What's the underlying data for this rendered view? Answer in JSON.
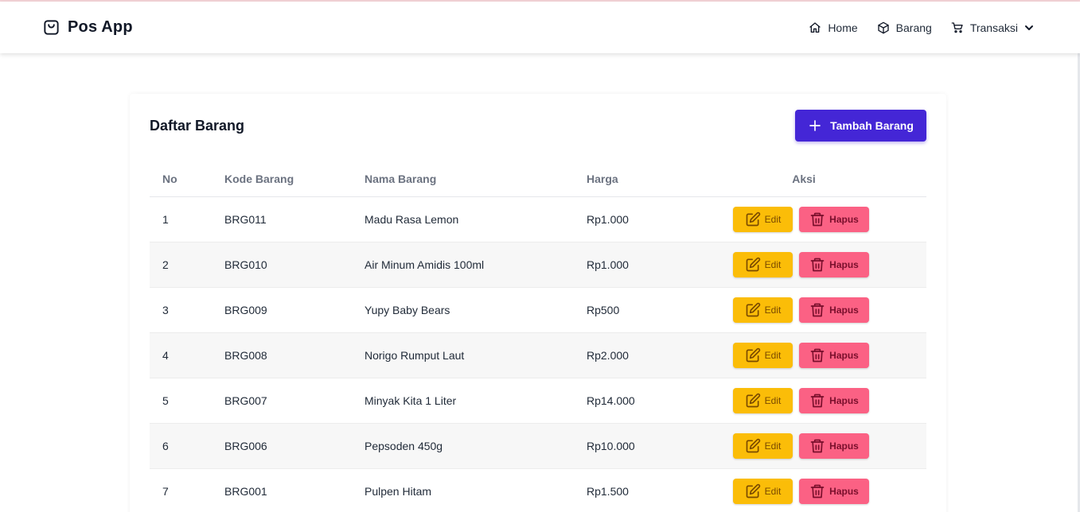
{
  "app": {
    "title": "Pos App"
  },
  "nav": {
    "home_label": "Home",
    "barang_label": "Barang",
    "transaksi_label": "Transaksi"
  },
  "page": {
    "title": "Daftar Barang",
    "add_button_label": "Tambah Barang"
  },
  "table": {
    "headers": {
      "no": "No",
      "kode": "Kode Barang",
      "nama": "Nama Barang",
      "harga": "Harga",
      "aksi": "Aksi"
    },
    "edit_label": "Edit",
    "delete_label": "Hapus",
    "rows": [
      {
        "no": "1",
        "kode": "BRG011",
        "nama": "Madu Rasa Lemon",
        "harga": "Rp1.000"
      },
      {
        "no": "2",
        "kode": "BRG010",
        "nama": "Air Minum Amidis 100ml",
        "harga": "Rp1.000"
      },
      {
        "no": "3",
        "kode": "BRG009",
        "nama": "Yupy Baby Bears",
        "harga": "Rp500"
      },
      {
        "no": "4",
        "kode": "BRG008",
        "nama": "Norigo Rumput Laut",
        "harga": "Rp2.000"
      },
      {
        "no": "5",
        "kode": "BRG007",
        "nama": "Minyak Kita 1 Liter",
        "harga": "Rp14.000"
      },
      {
        "no": "6",
        "kode": "BRG006",
        "nama": "Pepsoden 450g",
        "harga": "Rp10.000"
      },
      {
        "no": "7",
        "kode": "BRG001",
        "nama": "Pulpen Hitam",
        "harga": "Rp1.500"
      }
    ]
  },
  "colors": {
    "primary": "#4426d6",
    "edit_bg": "#fbbd08",
    "delete_bg": "#fb6184"
  },
  "icons": {
    "brand": "shopping-bag-icon",
    "home": "home-icon",
    "barang": "cube-icon",
    "transaksi": "cart-icon",
    "dropdown": "chevron-down-icon",
    "add": "plus-icon",
    "edit": "pencil-square-icon",
    "delete": "trash-icon"
  }
}
